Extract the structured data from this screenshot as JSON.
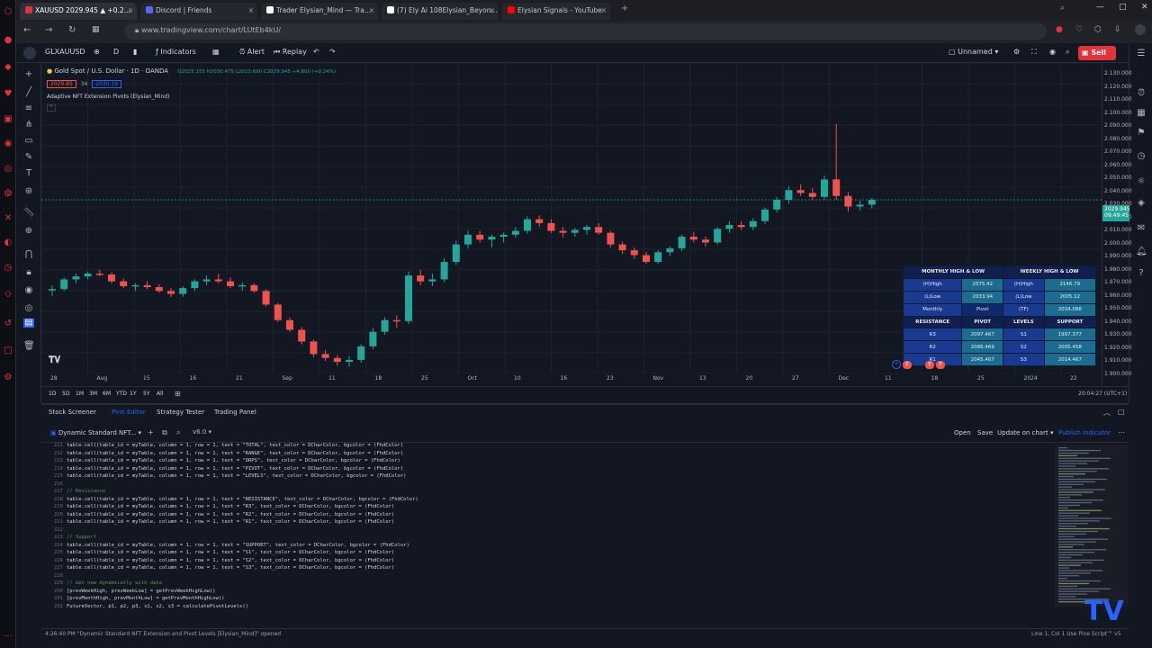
{
  "browser": {
    "tabs": [
      {
        "label": "XAUUSD 2029.945 ▲ +0.2...",
        "fav_color": "#e0343a",
        "active": true
      },
      {
        "label": "Discord | Friends",
        "fav_color": "#5865f2",
        "active": false
      },
      {
        "label": "Trader Elysian_Mind — Tra...",
        "fav_color": "#ffffff",
        "active": false
      },
      {
        "label": "(7) Ely Ai 108Elysian_Beyon...",
        "fav_color": "#ffffff",
        "active": false
      },
      {
        "label": "Elysian Signals - YouTube",
        "fav_color": "#ff0000",
        "active": false
      }
    ],
    "url": "www.tradingview.com/chart/LUtEb4kU/"
  },
  "toolbar": {
    "symbol": "GLXAUUSD",
    "indicators": "Indicators",
    "alert": "Alert",
    "replay": "Replay",
    "layout": "Unnamed",
    "publish": "Sell"
  },
  "chart": {
    "title": "Gold Spot / U.S. Dollar · 1D · OANDA",
    "ohlc": "O2025.155 H2030.475 L2023.690 C2029.945 +4.800 (+0.24%)",
    "sell_price": "2029.85",
    "buy_price": "2030.19",
    "spread": "34",
    "indicator_name": "Adaptive NFT Extension Pivots (Elysian_Mind)",
    "current_price": "2029.945",
    "countdown": "09:49:45",
    "price_ticks": [
      "2.130.000",
      "2.120.000",
      "2.110.000",
      "2.100.000",
      "2.090.000",
      "2.080.000",
      "2.070.000",
      "2.060.000",
      "2.050.000",
      "2.040.000",
      "2.030.000",
      "2.020.000",
      "2.010.000",
      "2.000.000",
      "1.990.000",
      "1.980.000",
      "1.970.000",
      "1.960.000",
      "1.950.000",
      "1.940.000",
      "1.930.000",
      "1.920.000",
      "1.910.000",
      "1.900.000"
    ],
    "time_ticks": [
      "28",
      "Aug",
      "15",
      "16",
      "21",
      "Sep",
      "11",
      "18",
      "25",
      "Oct",
      "10",
      "16",
      "23",
      "Nov",
      "13",
      "20",
      "27",
      "Dec",
      "11",
      "18",
      "25",
      "2024",
      "22"
    ],
    "ranges": [
      "1D",
      "5D",
      "1M",
      "3M",
      "6M",
      "YTD",
      "1Y",
      "5Y",
      "All"
    ],
    "utc": "20:04:27 (UTC+1)"
  },
  "pivot_table": {
    "headers": [
      "MONTHLY HIGH & LOW",
      "",
      "WEEKLY HIGH & LOW"
    ],
    "rows": [
      [
        "(H)High",
        "2075.42",
        "(H)High",
        "2146.79"
      ],
      [
        "(L)Low",
        "2033.94",
        "(L)Low",
        "2005.12"
      ],
      [
        "Monthly",
        "Pivot",
        "(TF)",
        "2034.088"
      ],
      [
        "RESISTANCE",
        "PIVOT",
        "LEVELS",
        "SUPPORT"
      ],
      [
        "R3",
        "2097.467",
        "S1",
        "1997.377"
      ],
      [
        "R2",
        "2086.469",
        "S2",
        "2005.458"
      ],
      [
        "R1",
        "2045.467",
        "S3",
        "2014.467"
      ]
    ]
  },
  "panel_tabs": [
    "Stock Screener",
    "Pine Editor",
    "Strategy Tester",
    "Trading Panel"
  ],
  "editor": {
    "script_name": "Dynamic Standard NFT...",
    "open": "Open",
    "save": "Save",
    "update": "Update on chart",
    "publish": "Publish indicator",
    "lines": [
      {
        "n": "211",
        "t": "table.cell(table_id = myTable, column = 1, row = 1, text = \"TOTAL\", text_color = DCharColor, bgcolor = (FhdColor)",
        "c": false
      },
      {
        "n": "212",
        "t": "table.cell(table_id = myTable, column = 1, row = 1, text = \"RANGE\", text_color = DCharColor, bgcolor = (FhdColor)",
        "c": false
      },
      {
        "n": "213",
        "t": "table.cell(table_id = myTable, column = 1, row = 1, text = \"DRPS\", text_color = DCharColor, bgcolor = (FhdColor)",
        "c": false
      },
      {
        "n": "214",
        "t": "table.cell(table_id = myTable, column = 1, row = 1, text = \"PIVOT\", text_color = DCharColor, bgcolor = (FhdColor)",
        "c": false
      },
      {
        "n": "215",
        "t": "table.cell(table_id = myTable, column = 1, row = 1, text = \"LEVELS\", text_color = DCharColor, bgcolor = (FhdColor)",
        "c": false
      },
      {
        "n": "216",
        "t": "",
        "c": false
      },
      {
        "n": "217",
        "t": "// Resistance",
        "c": true
      },
      {
        "n": "218",
        "t": "table.cell(table_id = myTable, column = 1, row = 1, text = \"RESISTANCE\", text_color = DCharColor, bgcolor = (FhdColor)",
        "c": false
      },
      {
        "n": "219",
        "t": "table.cell(table_id = myTable, column = 1, row = 1, text = \"R3\", text_color = DCharColor, bgcolor = (FhdColor)",
        "c": false
      },
      {
        "n": "220",
        "t": "table.cell(table_id = myTable, column = 1, row = 1, text = \"R2\", text_color = DCharColor, bgcolor = (FhdColor)",
        "c": false
      },
      {
        "n": "221",
        "t": "table.cell(table_id = myTable, column = 1, row = 1, text = \"R1\", text_color = DCharColor, bgcolor = (FhdColor)",
        "c": false
      },
      {
        "n": "222",
        "t": "",
        "c": false
      },
      {
        "n": "223",
        "t": "// Support",
        "c": true
      },
      {
        "n": "224",
        "t": "table.cell(table_id = myTable, column = 1, row = 1, text = \"SUPPORT\", text_color = DCharColor, bgcolor = (FhdColor)",
        "c": false
      },
      {
        "n": "225",
        "t": "table.cell(table_id = myTable, column = 1, row = 1, text = \"S1\", text_color = DCharColor, bgcolor = (FhdColor)",
        "c": false
      },
      {
        "n": "226",
        "t": "table.cell(table_id = myTable, column = 1, row = 1, text = \"S2\", text_color = DCharColor, bgcolor = (FhdColor)",
        "c": false
      },
      {
        "n": "227",
        "t": "table.cell(table_id = myTable, column = 1, row = 1, text = \"S3\", text_color = DCharColor, bgcolor = (FhdColor)",
        "c": false
      },
      {
        "n": "228",
        "t": "",
        "c": false
      },
      {
        "n": "229",
        "t": "// Get new dynamically with data",
        "c": true
      },
      {
        "n": "230",
        "t": "[prevWeekHigh, prevWeekLow] = getPrevWeekHighLow()",
        "c": false
      },
      {
        "n": "231",
        "t": "[prevMonthHigh, prevMonthLow] = getPrevMonthHighLow()",
        "c": false
      },
      {
        "n": "232",
        "t": "FutureVector, p1, p2, p3, s1, s2, s3 = calculatePivotLevels()",
        "c": false
      }
    ]
  },
  "status": {
    "left": "4:26:40 PM  \"Dynamic Standard NFT Extension and Pivot Levels [Elysian_Mind]\" opened",
    "right": "Line 1, Col 1    Use    Pine Script™ v5"
  },
  "colors": {
    "up": "#26a69a",
    "down": "#ef5350",
    "bg": "#131722",
    "accent": "#2962ff"
  },
  "chart_data": {
    "type": "candlestick",
    "candles": [
      [
        1901,
        1906,
        1895,
        1902
      ],
      [
        1902,
        1914,
        1900,
        1912
      ],
      [
        1912,
        1918,
        1908,
        1915
      ],
      [
        1915,
        1920,
        1912,
        1918
      ],
      [
        1918,
        1922,
        1915,
        1917
      ],
      [
        1917,
        1919,
        1908,
        1910
      ],
      [
        1910,
        1913,
        1903,
        1905
      ],
      [
        1905,
        1908,
        1900,
        1906
      ],
      [
        1906,
        1910,
        1902,
        1904
      ],
      [
        1904,
        1907,
        1898,
        1900
      ],
      [
        1900,
        1903,
        1894,
        1897
      ],
      [
        1897,
        1905,
        1894,
        1903
      ],
      [
        1903,
        1912,
        1900,
        1910
      ],
      [
        1910,
        1916,
        1906,
        1912
      ],
      [
        1912,
        1918,
        1908,
        1910
      ],
      [
        1910,
        1914,
        1903,
        1905
      ],
      [
        1905,
        1909,
        1900,
        1906
      ],
      [
        1906,
        1908,
        1898,
        1900
      ],
      [
        1900,
        1902,
        1884,
        1886
      ],
      [
        1886,
        1888,
        1868,
        1870
      ],
      [
        1870,
        1873,
        1858,
        1860
      ],
      [
        1860,
        1863,
        1845,
        1848
      ],
      [
        1848,
        1850,
        1832,
        1835
      ],
      [
        1835,
        1839,
        1828,
        1831
      ],
      [
        1831,
        1834,
        1823,
        1827
      ],
      [
        1827,
        1833,
        1822,
        1829
      ],
      [
        1829,
        1845,
        1826,
        1843
      ],
      [
        1843,
        1862,
        1840,
        1858
      ],
      [
        1858,
        1873,
        1855,
        1870
      ],
      [
        1870,
        1875,
        1862,
        1869
      ],
      [
        1869,
        1920,
        1866,
        1916
      ],
      [
        1916,
        1922,
        1906,
        1910
      ],
      [
        1910,
        1918,
        1905,
        1912
      ],
      [
        1912,
        1934,
        1909,
        1930
      ],
      [
        1930,
        1952,
        1927,
        1948
      ],
      [
        1948,
        1962,
        1944,
        1958
      ],
      [
        1958,
        1962,
        1950,
        1953
      ],
      [
        1953,
        1958,
        1945,
        1956
      ],
      [
        1956,
        1960,
        1950,
        1958
      ],
      [
        1958,
        1966,
        1955,
        1962
      ],
      [
        1962,
        1977,
        1959,
        1974
      ],
      [
        1974,
        1978,
        1966,
        1970
      ],
      [
        1970,
        1974,
        1960,
        1962
      ],
      [
        1962,
        1966,
        1955,
        1960
      ],
      [
        1960,
        1965,
        1956,
        1963
      ],
      [
        1963,
        1968,
        1958,
        1966
      ],
      [
        1966,
        1970,
        1958,
        1960
      ],
      [
        1960,
        1962,
        1945,
        1948
      ],
      [
        1948,
        1951,
        1938,
        1942
      ],
      [
        1942,
        1945,
        1933,
        1937
      ],
      [
        1937,
        1940,
        1928,
        1930
      ],
      [
        1930,
        1942,
        1928,
        1940
      ],
      [
        1940,
        1946,
        1936,
        1944
      ],
      [
        1944,
        1958,
        1941,
        1956
      ],
      [
        1956,
        1961,
        1950,
        1953
      ],
      [
        1953,
        1956,
        1946,
        1950
      ],
      [
        1950,
        1966,
        1948,
        1964
      ],
      [
        1964,
        1972,
        1960,
        1968
      ],
      [
        1968,
        1972,
        1963,
        1966
      ],
      [
        1966,
        1975,
        1963,
        1972
      ],
      [
        1972,
        1986,
        1969,
        1984
      ],
      [
        1984,
        1997,
        1981,
        1994
      ],
      [
        1994,
        2008,
        1990,
        2004
      ],
      [
        2004,
        2010,
        1998,
        2001
      ],
      [
        2001,
        2006,
        1994,
        1997
      ],
      [
        1997,
        2019,
        1994,
        2015
      ],
      [
        2015,
        2072,
        1994,
        1998
      ],
      [
        1998,
        2002,
        1982,
        1987
      ],
      [
        1987,
        1993,
        1983,
        1989
      ],
      [
        1989,
        1996,
        1985,
        1994
      ]
    ]
  }
}
